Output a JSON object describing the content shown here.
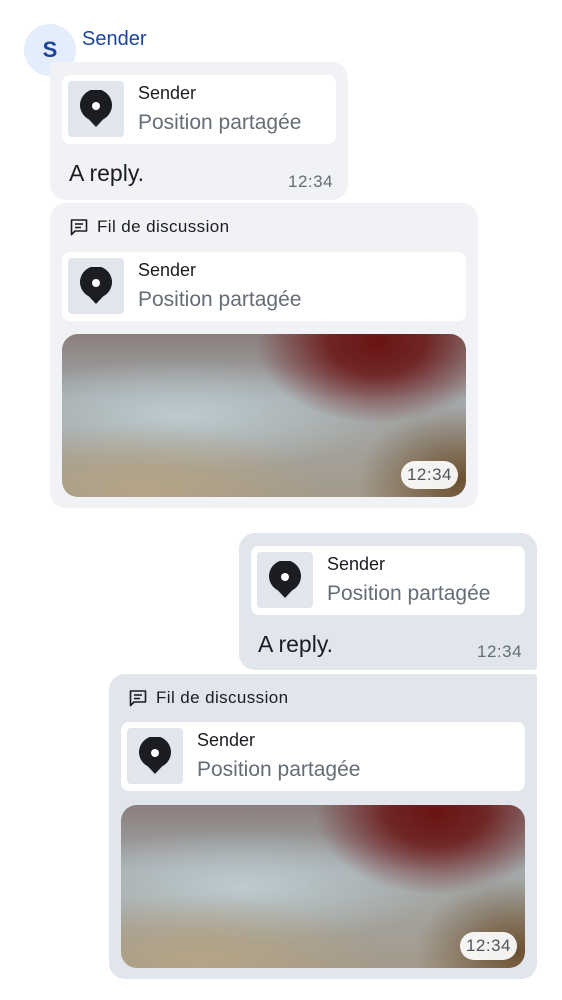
{
  "sender": {
    "avatar_letter": "S",
    "name": "Sender"
  },
  "thread_label": "Fil de discussion",
  "messages": [
    {
      "direction": "incoming",
      "reply_to": {
        "name": "Sender",
        "subtitle": "Position partagée"
      },
      "text": "A reply.",
      "timestamp": "12:34"
    },
    {
      "direction": "incoming",
      "thread": true,
      "reply_to": {
        "name": "Sender",
        "subtitle": "Position partagée"
      },
      "image": true,
      "timestamp": "12:34"
    },
    {
      "direction": "outgoing",
      "reply_to": {
        "name": "Sender",
        "subtitle": "Position partagée"
      },
      "text": "A reply.",
      "timestamp": "12:34"
    },
    {
      "direction": "outgoing",
      "thread": true,
      "reply_to": {
        "name": "Sender",
        "subtitle": "Position partagée"
      },
      "image": true,
      "timestamp": "12:34"
    }
  ],
  "colors": {
    "accent": "#1b4598",
    "bubble_incoming": "#f0f2f5",
    "bubble_outgoing": "#e1e5ec",
    "secondary_text": "#656d77"
  },
  "icons": {
    "location": "location-pin-icon",
    "thread": "thread-icon"
  }
}
